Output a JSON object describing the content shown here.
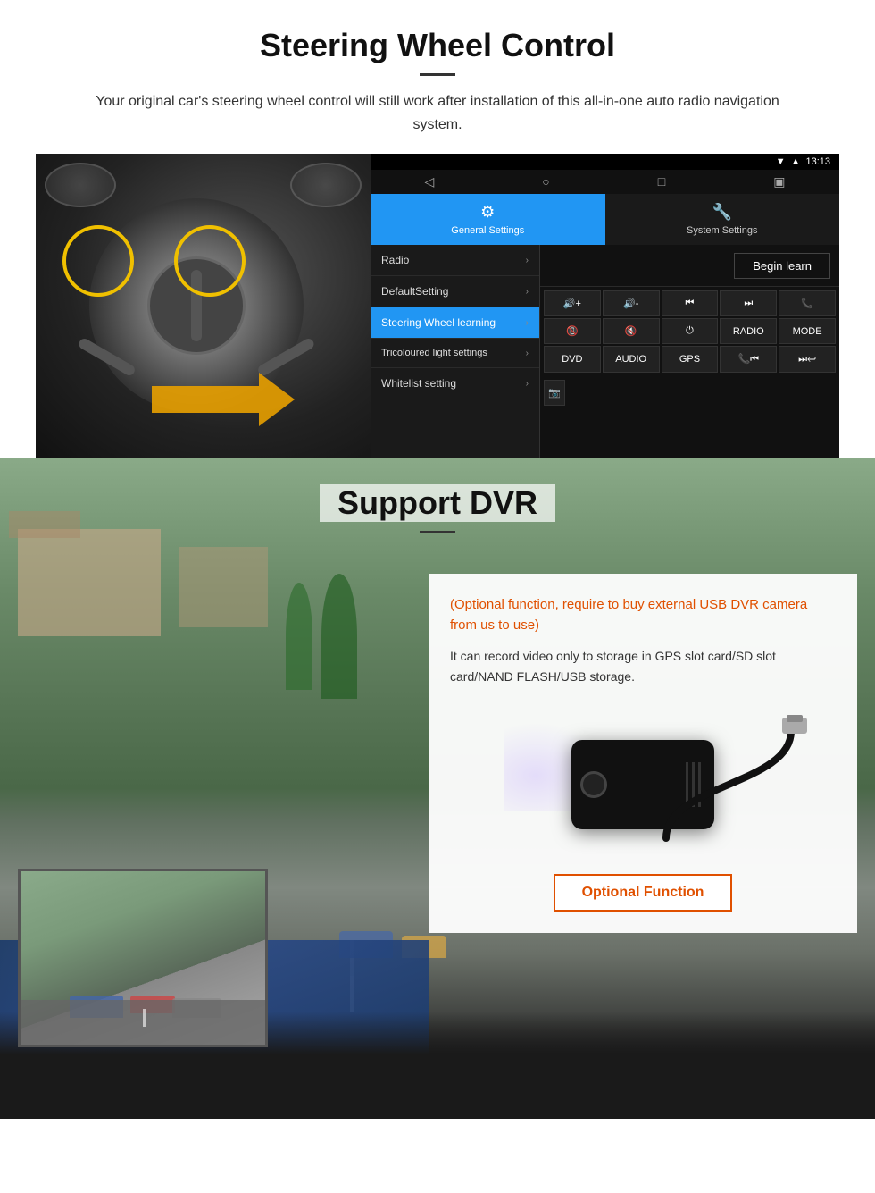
{
  "page": {
    "section1": {
      "title": "Steering Wheel Control",
      "subtitle": "Your original car's steering wheel control will still work after installation of this all-in-one auto radio navigation system.",
      "divider_visible": true
    },
    "android_ui": {
      "statusbar": {
        "time": "13:13",
        "icons": [
          "signal",
          "wifi",
          "battery"
        ]
      },
      "navbar": {
        "buttons": [
          "◁",
          "○",
          "□",
          "▣"
        ]
      },
      "tabs": [
        {
          "label": "General Settings",
          "active": true,
          "icon": "⚙"
        },
        {
          "label": "System Settings",
          "active": false,
          "icon": "🔧"
        }
      ],
      "menu_items": [
        {
          "label": "Radio",
          "active": false
        },
        {
          "label": "DefaultSetting",
          "active": false
        },
        {
          "label": "Steering Wheel learning",
          "active": true
        },
        {
          "label": "Tricoloured light settings",
          "active": false
        },
        {
          "label": "Whitelist setting",
          "active": false
        }
      ],
      "begin_learn": "Begin learn",
      "control_buttons": [
        "🔊+",
        "🔊-",
        "⏮",
        "⏭",
        "📞",
        "☎",
        "🔇",
        "⏻",
        "RADIO",
        "MODE",
        "DVD",
        "AUDIO",
        "GPS",
        "📞⏮",
        "⏭"
      ],
      "extra_btn": "📷"
    },
    "section2": {
      "title": "Support DVR",
      "card": {
        "orange_text": "(Optional function, require to buy external USB DVR camera from us to use)",
        "body_text": "It can record video only to storage in GPS slot card/SD slot card/NAND FLASH/USB storage.",
        "optional_button_label": "Optional Function"
      }
    }
  }
}
